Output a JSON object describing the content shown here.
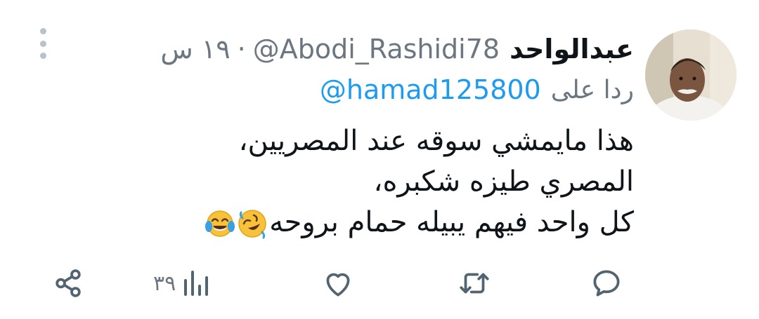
{
  "tweet": {
    "author_name": "عبدالواحد",
    "handle": "@Abodi_Rashidi78",
    "dot": "·",
    "time": "١٩ س",
    "replying_label": "ردا على",
    "replying_to": "@hamad125800",
    "text_lines": [
      "هذا مايمشي سوقه عند المصريين،",
      "المصري طيزه شكبره،",
      "كل واحد فيهم يبيله حمام بروحه"
    ],
    "emojis": [
      "rolling-on-floor-laughing-emoji",
      "face-with-tears-of-joy-emoji"
    ]
  },
  "actions": {
    "reply_icon": "reply-icon",
    "retweet_icon": "retweet-icon",
    "like_icon": "heart-icon",
    "views_icon": "views-icon",
    "views_count": "٣٩",
    "share_icon": "share-icon"
  },
  "colors": {
    "text": "#0f1419",
    "secondary": "#6b7680",
    "link": "#1d9bf0",
    "icon": "#536471"
  }
}
